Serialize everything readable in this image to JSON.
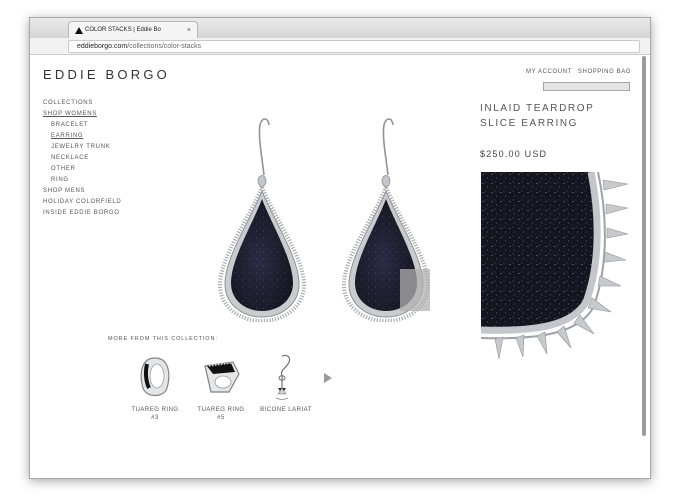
{
  "browser": {
    "tab_title": "COLOR STACKS | Eddie Bo",
    "tab_close": "×",
    "url_domain": "eddieborgo.com",
    "url_path": "/collections/color-stacks"
  },
  "header": {
    "logo": "EDDIE BORGO",
    "my_account": "MY ACCOUNT",
    "shopping_bag": "SHOPPING BAG"
  },
  "sidebar": {
    "items": [
      {
        "label": "COLLECTIONS"
      },
      {
        "label": "SHOP WOMENS"
      },
      {
        "label": "BRACELET"
      },
      {
        "label": "EARRING"
      },
      {
        "label": "JEWELRY TRUNK"
      },
      {
        "label": "NECKLACE"
      },
      {
        "label": "OTHER"
      },
      {
        "label": "RING"
      },
      {
        "label": "SHOP MENS"
      },
      {
        "label": "HOLIDAY COLORFIELD"
      },
      {
        "label": "INSIDE EDDIE BORGO"
      }
    ]
  },
  "product": {
    "title": "INLAID TEARDROP SLICE EARRING",
    "price": "$250.00 USD"
  },
  "more": {
    "label": "MORE FROM THIS COLLECTION:",
    "items": [
      {
        "name": "TUAREG RING",
        "sub": "#3"
      },
      {
        "name": "TUAREG RING",
        "sub": "#5"
      },
      {
        "name": "BICONE LARIAT",
        "sub": ""
      }
    ]
  },
  "icons": {
    "next": "triangle-right"
  },
  "colors": {
    "stone": "#1c1c2e",
    "metal": "#b9bcc0",
    "zoom_lens": "#b0b0b0"
  }
}
